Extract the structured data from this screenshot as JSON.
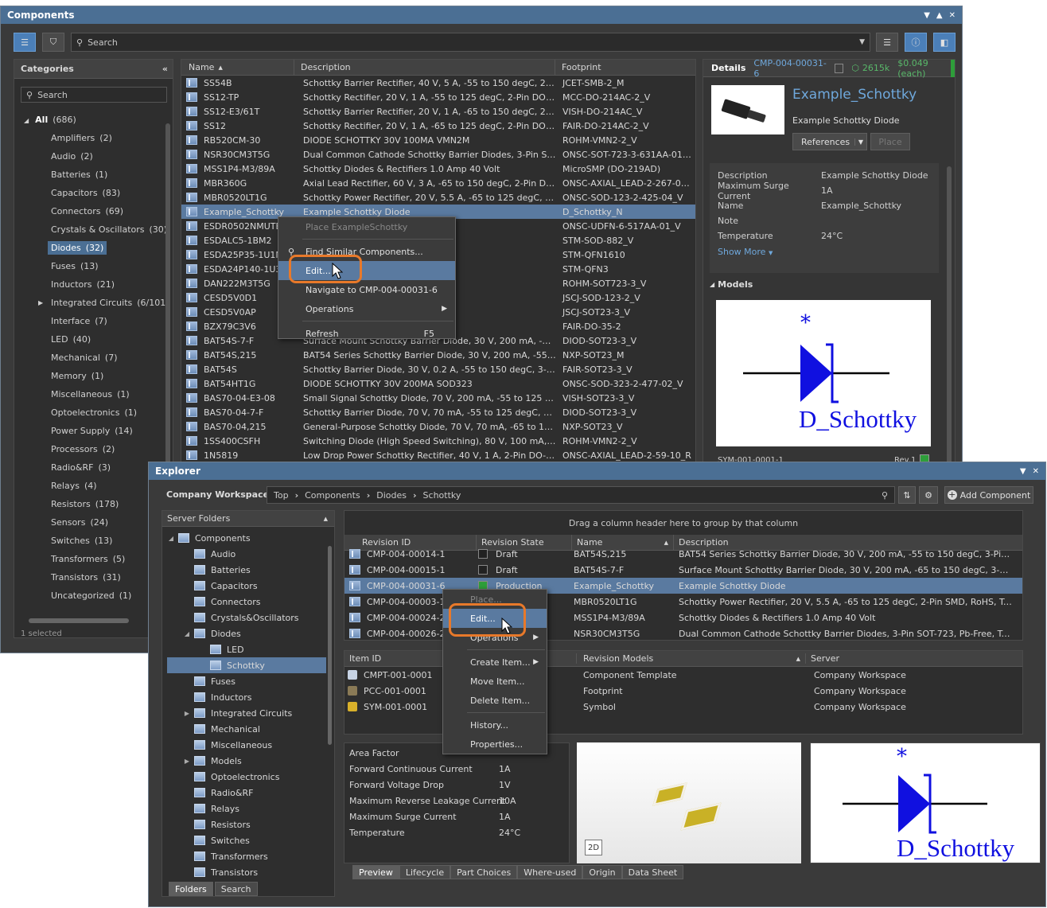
{
  "components": {
    "title": "Components",
    "search_placeholder": "Search",
    "categories": {
      "header": "Categories",
      "search_placeholder": "Search",
      "items": [
        {
          "label": "All",
          "count": "(686)"
        },
        {
          "label": "Amplifiers",
          "count": "(2)"
        },
        {
          "label": "Audio",
          "count": "(2)"
        },
        {
          "label": "Batteries",
          "count": "(1)"
        },
        {
          "label": "Capacitors",
          "count": "(83)"
        },
        {
          "label": "Connectors",
          "count": "(69)"
        },
        {
          "label": "Crystals & Oscillators",
          "count": "(30)"
        },
        {
          "label": "Diodes",
          "count": "(32)"
        },
        {
          "label": "Fuses",
          "count": "(13)"
        },
        {
          "label": "Inductors",
          "count": "(21)"
        },
        {
          "label": "Integrated Circuits",
          "count": "(6/101"
        },
        {
          "label": "Interface",
          "count": "(7)"
        },
        {
          "label": "LED",
          "count": "(40)"
        },
        {
          "label": "Mechanical",
          "count": "(7)"
        },
        {
          "label": "Memory",
          "count": "(1)"
        },
        {
          "label": "Miscellaneous",
          "count": "(1)"
        },
        {
          "label": "Optoelectronics",
          "count": "(1)"
        },
        {
          "label": "Power Supply",
          "count": "(14)"
        },
        {
          "label": "Processors",
          "count": "(2)"
        },
        {
          "label": "Radio&RF",
          "count": "(3)"
        },
        {
          "label": "Relays",
          "count": "(4)"
        },
        {
          "label": "Resistors",
          "count": "(178)"
        },
        {
          "label": "Sensors",
          "count": "(24)"
        },
        {
          "label": "Switches",
          "count": "(13)"
        },
        {
          "label": "Transformers",
          "count": "(5)"
        },
        {
          "label": "Transistors",
          "count": "(31)"
        },
        {
          "label": "Uncategorized",
          "count": "(1)"
        }
      ],
      "status": "1 selected"
    },
    "table": {
      "headers": [
        "Name",
        "Description",
        "Footprint"
      ],
      "rows": [
        [
          "SS54B",
          "Schottky Barrier Rectifier, 40 V, 5 A, -55 to 150 degC, 2-Pin S...",
          "JCET-SMB-2_M"
        ],
        [
          "SS12-TP",
          "Schottky Rectifier, 20 V, 1 A, -55 to 125 degC, 2-Pin DO-214A...",
          "MCC-DO-214AC-2_V"
        ],
        [
          "SS12-E3/61T",
          "Schottky Barrier Rectifier, 20 V, 1 A, -65 to 150 degC, 2-Pin D...",
          "VISH-DO-214AC_V"
        ],
        [
          "SS12",
          "Schottky Rectifier, 20 V, 1 A, -65 to 125 degC, 2-Pin DO-214A...",
          "FAIR-DO-214AC-2_V"
        ],
        [
          "RB520CM-30",
          "DIODE SCHOTTKY 30V 100MA VMN2M",
          "ROHM-VMN2-2_V"
        ],
        [
          "NSR30CM3T5G",
          "Dual Common Cathode Schottky Barrier Diodes, 3-Pin SOT-7...",
          "ONSC-SOT-723-3-631AA-01_C_V"
        ],
        [
          "MSS1P4-M3/89A",
          "Schottky Diodes & Rectifiers 1.0 Amp 40 Volt",
          "MicroSMP (DO-219AD)"
        ],
        [
          "MBR360G",
          "Axial Lead Rectifier, 60 V, 3 A, -65 to 150 degC, 2-Pin DO-201...",
          "ONSC-AXIAL_LEAD-2-267-05_V"
        ],
        [
          "MBR0520LT1G",
          "Schottky Power Rectifier, 20 V, 5.5 A, -65 to 125 degC, 2-Pin S...",
          "ONSC-SOD-123-2-425-04_V"
        ],
        [
          "Example_Schottky",
          "Example Schottky Diode",
          "D_Schottky_N"
        ],
        [
          "ESDR0502NMUTBG",
          "Array for High Speed...",
          "ONSC-UDFN-6-517AA-01_V"
        ],
        [
          "ESDALC5-1BM2",
          "V, -55 to 150 degC, 2...",
          "STM-SOD-882_V"
        ],
        [
          "ESDA25P35-1U1M",
          "",
          "STM-QFN1610"
        ],
        [
          "ESDA24P140-1U3M",
          "clamp",
          "STM-QFN3"
        ],
        [
          "DAN222M3T5G",
          "ng Diodes, 3-Pin SOT-...",
          "ROHM-SOT723-3_V"
        ],
        [
          "CESD5V0D1",
          "-65 to 150 degC, 2-Pi...",
          "JSCJ-SOD-123-2_V"
        ],
        [
          "CESD5V0AP",
          "V, 10 uA, 3-Pin SOT23,...",
          "JSCJ-SOT23-3_V"
        ],
        [
          "BZX79C3V6",
          "C, 2-Pin DO-35, RoH...",
          "FAIR-DO-35-2"
        ],
        [
          "BAT54S-7-F",
          "Surface Mount Schottky Barrier Diode, 30 V, 200 mA, -65 to 1...",
          "DIOD-SOT23-3_V"
        ],
        [
          "BAT54S,215",
          "BAT54 Series Schottky Barrier Diode, 30 V, 200 mA, -55 to 150...",
          "NXP-SOT23_M"
        ],
        [
          "BAT54S",
          "Schottky Barrier Diode, 30 V, 0.2 A, -55 to 150 degC, 3-Pin SO...",
          "FAIR-SOT23-3_V"
        ],
        [
          "BAT54HT1G",
          "DIODE SCHOTTKY 30V 200MA SOD323",
          "ONSC-SOD-323-2-477-02_V"
        ],
        [
          "BAS70-04-E3-08",
          "Small Signal Schottky Diode, 70 V, 200 mA, -55 to 125 degC,...",
          "VISH-SOT23-3_V"
        ],
        [
          "BAS70-04-7-F",
          "Schottky Barrier Diode, 70 V, 70 mA, -55 to 125 degC, 3-Pin S...",
          "DIOD-SOT23-3_V"
        ],
        [
          "BAS70-04,215",
          "General-Purpose Schottky Diode, 70 V, 70 mA, -65 to 150 deg...",
          "NXP-SOT23_V"
        ],
        [
          "1SS400CSFH",
          "Switching Diode (High Speed Switching), 80 V, 100 mA, 2-Pin...",
          "ROHM-VMN2-2_V"
        ],
        [
          "1N5819",
          "Low Drop Power Schottky Rectifier, 40 V, 1 A, 2-Pin DO-41, R...",
          "ONSC-AXIAL_LEAD-2-59-10_R"
        ]
      ]
    },
    "context_menu": {
      "items": [
        "Place ExampleSchottky",
        "Find Similar Components...",
        "Edit...",
        "Navigate to CMP-004-00031-6",
        "Operations",
        "Refresh"
      ],
      "refresh_shortcut": "F5"
    },
    "details": {
      "header": "Details",
      "id": "CMP-004-00031-6",
      "stock": "2615k",
      "price": "$0.049 (each)",
      "name": "Example_Schottky",
      "subtitle": "Example Schottky Diode",
      "references_label": "References",
      "place_label": "Place",
      "props": [
        [
          "Description",
          "Example Schottky Diode"
        ],
        [
          "Maximum Surge Current",
          "1A"
        ],
        [
          "Name",
          "Example_Schottky"
        ],
        [
          "Note",
          ""
        ],
        [
          "Temperature",
          "24°C"
        ]
      ],
      "show_more": "Show More",
      "models_header": "Models",
      "symbol_label": "D_Schottky",
      "symbol_star": "*",
      "symbol_id": "SYM-001-0001-1",
      "rev": "Rev.1"
    }
  },
  "explorer": {
    "title": "Explorer",
    "workspace": "Company Workspace",
    "breadcrumb": [
      "Top",
      "Components",
      "Diodes",
      "Schottky"
    ],
    "add_component": "Add Component",
    "server_folders": "Server Folders",
    "tree": [
      {
        "label": "Components",
        "level": 0,
        "tw": "▲"
      },
      {
        "label": "Audio",
        "level": 1,
        "tw": ""
      },
      {
        "label": "Batteries",
        "level": 1,
        "tw": ""
      },
      {
        "label": "Capacitors",
        "level": 1,
        "tw": ""
      },
      {
        "label": "Connectors",
        "level": 1,
        "tw": ""
      },
      {
        "label": "Crystals&Oscillators",
        "level": 1,
        "tw": ""
      },
      {
        "label": "Diodes",
        "level": 1,
        "tw": "▲"
      },
      {
        "label": "LED",
        "level": 2,
        "tw": ""
      },
      {
        "label": "Schottky",
        "level": 2,
        "tw": ""
      },
      {
        "label": "Fuses",
        "level": 1,
        "tw": ""
      },
      {
        "label": "Inductors",
        "level": 1,
        "tw": ""
      },
      {
        "label": "Integrated Circuits",
        "level": 1,
        "tw": "▶"
      },
      {
        "label": "Mechanical",
        "level": 1,
        "tw": ""
      },
      {
        "label": "Miscellaneous",
        "level": 1,
        "tw": ""
      },
      {
        "label": "Models",
        "level": 1,
        "tw": "▶"
      },
      {
        "label": "Optoelectronics",
        "level": 1,
        "tw": ""
      },
      {
        "label": "Radio&RF",
        "level": 1,
        "tw": ""
      },
      {
        "label": "Relays",
        "level": 1,
        "tw": ""
      },
      {
        "label": "Resistors",
        "level": 1,
        "tw": ""
      },
      {
        "label": "Switches",
        "level": 1,
        "tw": ""
      },
      {
        "label": "Transformers",
        "level": 1,
        "tw": ""
      },
      {
        "label": "Transistors",
        "level": 1,
        "tw": ""
      }
    ],
    "bottom_tabs": [
      "Folders",
      "Search"
    ],
    "group_hint": "Drag a column header here to group by that column",
    "rev_headers": [
      "Revision ID",
      "Revision State",
      "Name",
      "Description"
    ],
    "rev_rows": [
      [
        "CMP-004-00014-1",
        "Draft",
        "BAT54S,215",
        "BAT54 Series Schottky Barrier Diode, 30 V, 200 mA, -55 to 150 degC, 3-Pin SOT23..."
      ],
      [
        "CMP-004-00015-1",
        "Draft",
        "BAT54S-7-F",
        "Surface Mount Schottky Barrier Diode, 30 V, 200 mA, -65 to 150 degC, 3-Pin SOT..."
      ],
      [
        "CMP-004-00031-6",
        "Production",
        "Example_Schottky",
        "Example Schottky Diode"
      ],
      [
        "CMP-004-00003-1",
        "",
        "MBR0520LT1G",
        "Schottky Power Rectifier, 20 V, 5.5 A, -65 to 125 degC, 2-Pin SMD, RoHS, Tape an..."
      ],
      [
        "CMP-004-00024-2",
        "",
        "MSS1P4-M3/89A",
        "Schottky Diodes & Rectifiers 1.0 Amp 40 Volt"
      ],
      [
        "CMP-004-00026-2",
        "",
        "NSR30CM3T5G",
        "Dual Common Cathode Schottky Barrier Diodes, 3-Pin SOT-723, Pb-Free, Tape a..."
      ]
    ],
    "item_headers": [
      "Item ID",
      "Revision Models",
      "Server"
    ],
    "item_rows": [
      [
        "CMPT-001-0001",
        "Component Template",
        "Company Workspace"
      ],
      [
        "PCC-001-0001",
        "Footprint",
        "Company Workspace"
      ],
      [
        "SYM-001-0001",
        "Symbol",
        "Company Workspace"
      ]
    ],
    "context_menu": [
      "Place...",
      "Edit...",
      "Operations",
      "Create Item...",
      "Move Item...",
      "Delete Item...",
      "History...",
      "Properties..."
    ],
    "params": [
      [
        "Area Factor",
        ""
      ],
      [
        "Forward Continuous Current",
        "1A"
      ],
      [
        "Forward Voltage Drop",
        "1V"
      ],
      [
        "Maximum Reverse Leakage Current",
        "10A"
      ],
      [
        "Maximum Surge Current",
        "1A"
      ],
      [
        "Temperature",
        "24°C"
      ]
    ],
    "view_2d": "2D",
    "symbol_label": "D_Schottky",
    "symbol_star": "*",
    "preview_tabs": [
      "Preview",
      "Lifecycle",
      "Part Choices",
      "Where-used",
      "Origin",
      "Data Sheet"
    ]
  },
  "colors": {
    "titlebar": "#4b6f94",
    "accent_orange": "#e8792a",
    "selection": "#5a7aa0",
    "production_green": "#2e9e3a",
    "diode_blue": "#1010e0"
  }
}
